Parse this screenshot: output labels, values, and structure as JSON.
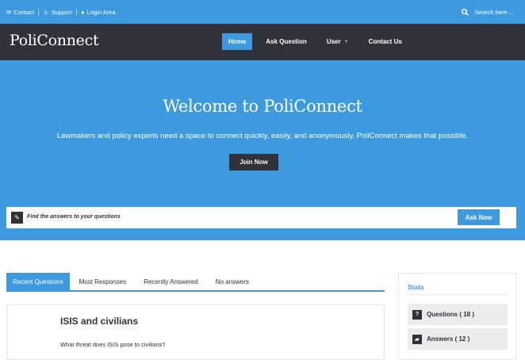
{
  "topbar": {
    "contact": "Contact",
    "support": "Support",
    "login": "Login Area",
    "search_placeholder": "Search here ..."
  },
  "brand": {
    "logo": "PoliConnect"
  },
  "nav": {
    "items": [
      "Home",
      "Ask Question",
      "User",
      "Contact Us"
    ],
    "active": "Home"
  },
  "hero": {
    "title": "Welcome to PoliConnect",
    "subtitle": "Lawmakers and policy experts need a space to connect quickly, easily, and anonymously. PoliConnect makes that possible.",
    "cta": "Join Now"
  },
  "ask": {
    "prompt": "Find the answers to your questions",
    "button": "Ask Now"
  },
  "tabs": {
    "items": [
      "Recent Questions",
      "Most Responses",
      "Recently Answered",
      "No answers"
    ],
    "active": "Recent Questions"
  },
  "questions": [
    {
      "title": "ISIS and civilians",
      "body": "What threat does ISIS pose to civilians?"
    }
  ],
  "stats": {
    "title": "Stats",
    "questions": "Questions ( 18 )",
    "answers": "Answers ( 12 )"
  },
  "colors": {
    "accent": "#3d9ade",
    "dark": "#2f3239"
  },
  "icons": [
    "envelope-icon",
    "support-icon",
    "user-icon",
    "search-icon",
    "pencil-icon",
    "question-icon",
    "comment-icon",
    "chevron-down-icon"
  ]
}
